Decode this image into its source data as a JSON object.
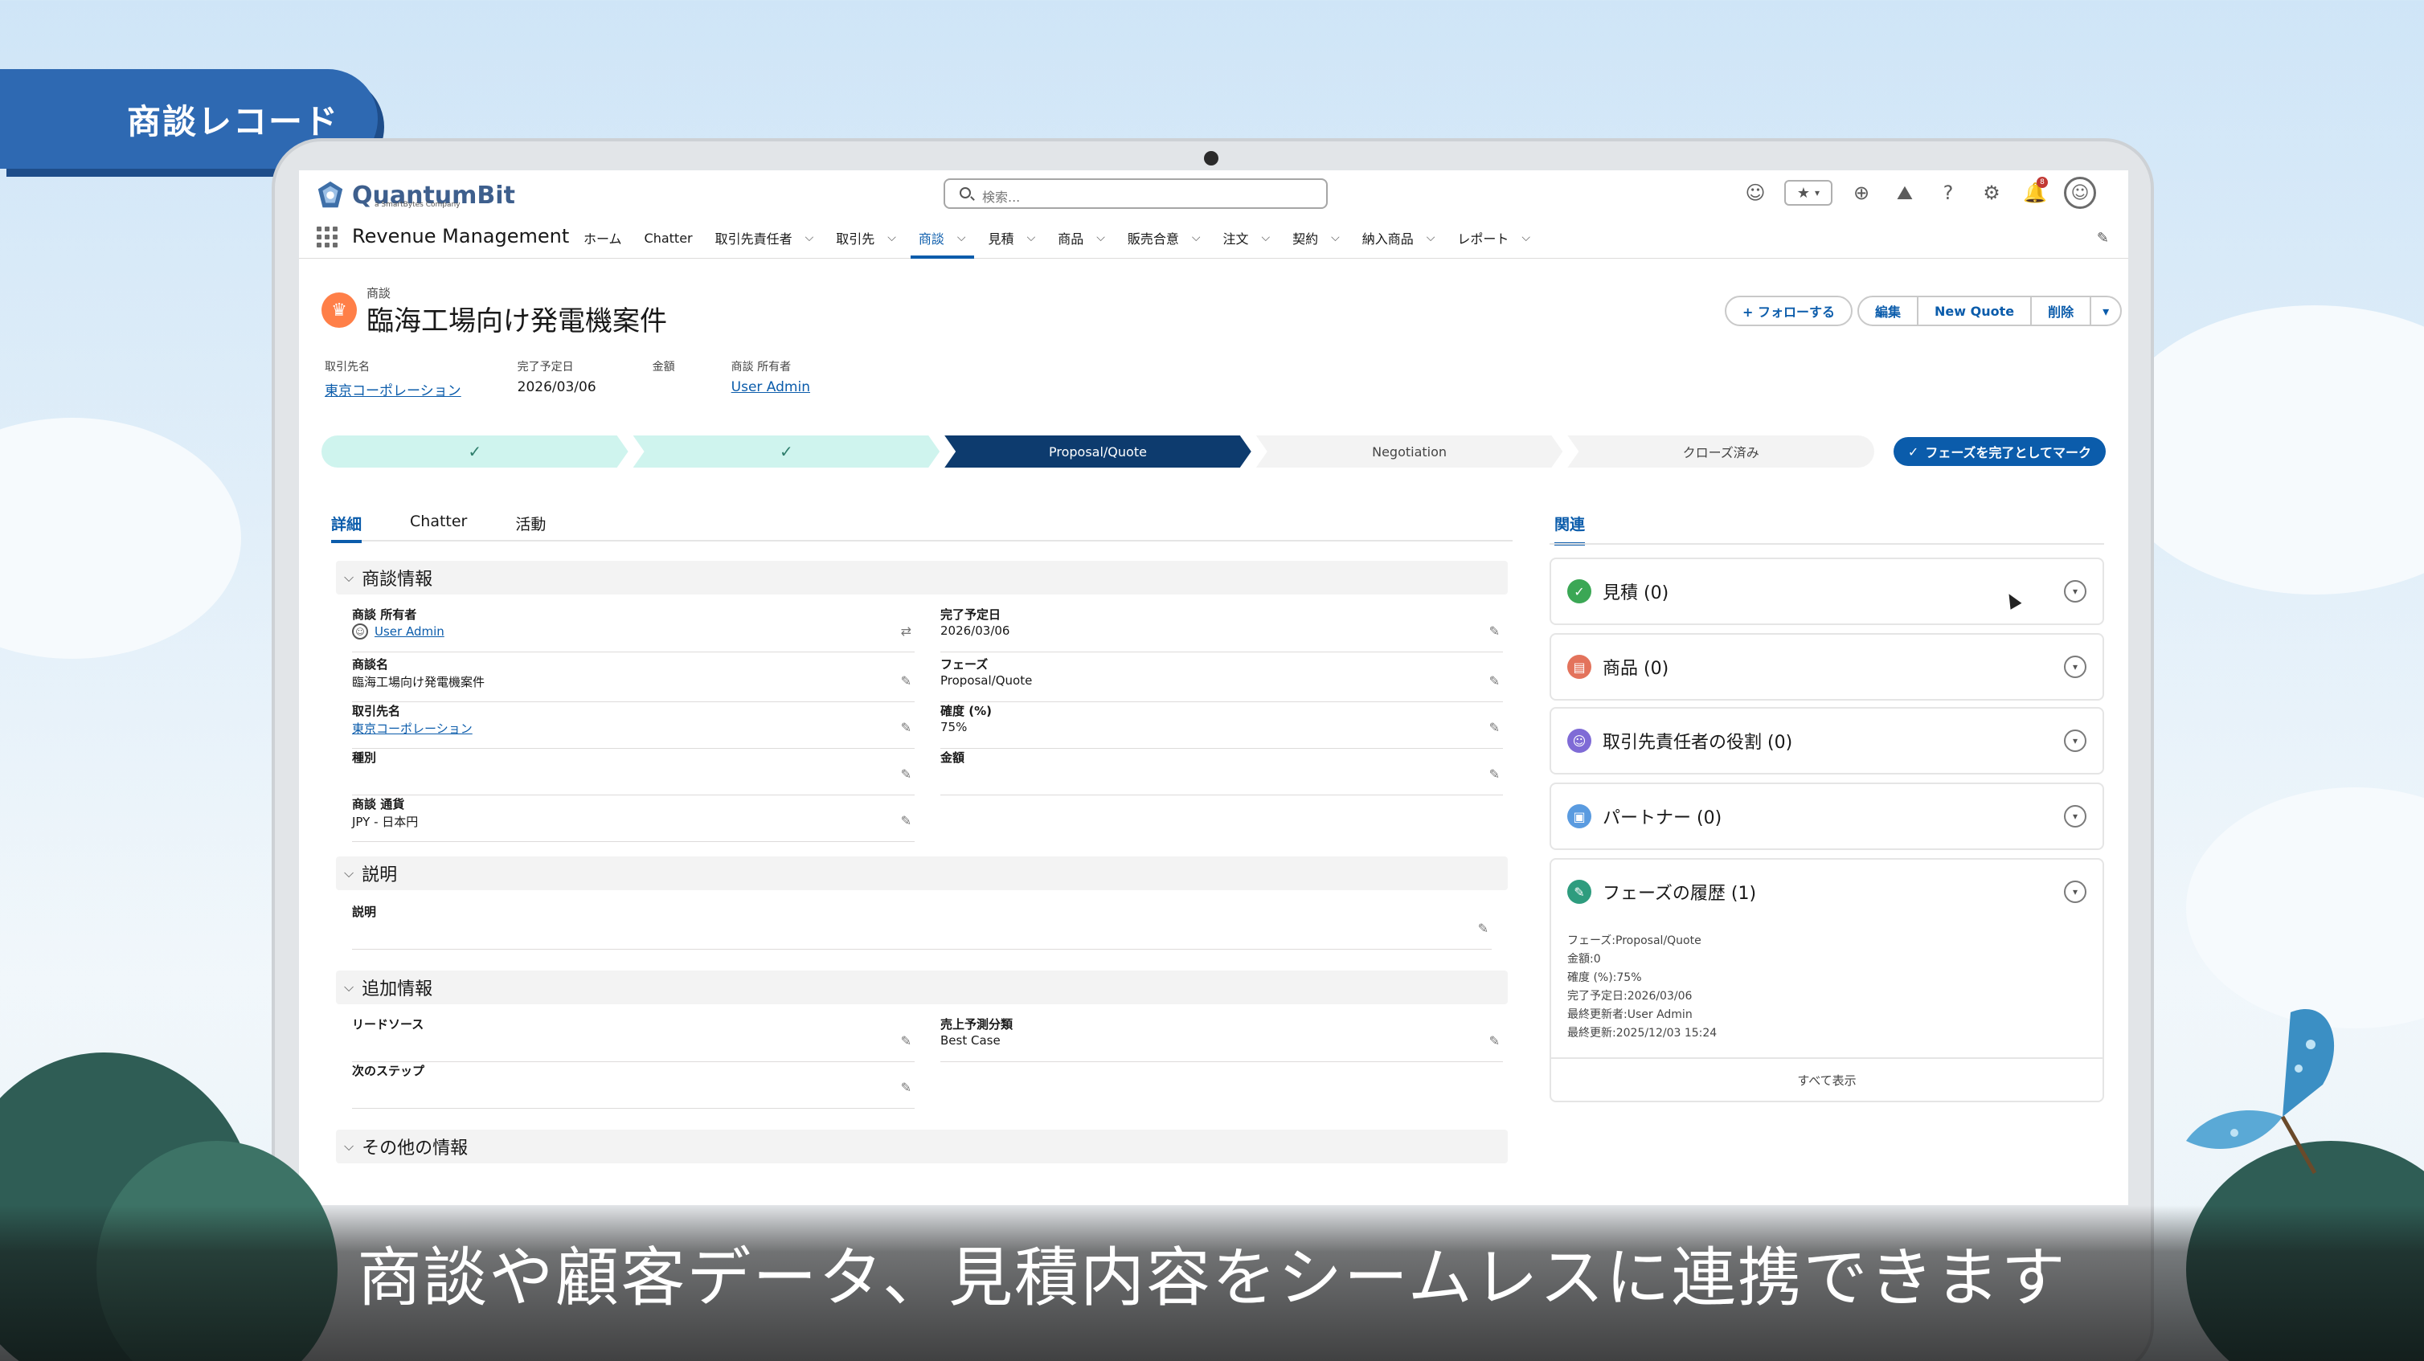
{
  "banner": {
    "title": "商談レコード"
  },
  "caption": {
    "text": "商談や顧客データ、見積内容をシームレスに連携できます"
  },
  "header": {
    "logo_text": "QuantumBit",
    "logo_sub": "a SmartBytes Company",
    "search_placeholder": "検索...",
    "notification_count": "8"
  },
  "nav": {
    "app_name": "Revenue Management",
    "items": [
      {
        "label": "ホーム",
        "has_menu": false
      },
      {
        "label": "Chatter",
        "has_menu": false
      },
      {
        "label": "取引先責任者",
        "has_menu": true
      },
      {
        "label": "取引先",
        "has_menu": true
      },
      {
        "label": "商談",
        "has_menu": true,
        "active": true
      },
      {
        "label": "見積",
        "has_menu": true
      },
      {
        "label": "商品",
        "has_menu": true
      },
      {
        "label": "販売合意",
        "has_menu": true
      },
      {
        "label": "注文",
        "has_menu": true
      },
      {
        "label": "契約",
        "has_menu": true
      },
      {
        "label": "納入商品",
        "has_menu": true
      },
      {
        "label": "レポート",
        "has_menu": true
      }
    ]
  },
  "record": {
    "object_label": "商談",
    "title": "臨海工場向け発電機案件",
    "actions": {
      "follow": "+ フォローする",
      "edit": "編集",
      "new_quote": "New Quote",
      "delete": "削除"
    },
    "highlights": [
      {
        "label": "取引先名",
        "value": "東京コーポレーション",
        "link": true
      },
      {
        "label": "完了予定日",
        "value": "2026/03/06",
        "link": false
      },
      {
        "label": "金額",
        "value": "",
        "link": false
      },
      {
        "label": "商談 所有者",
        "value": "User Admin",
        "link": true
      }
    ]
  },
  "path": {
    "steps": [
      {
        "label": "✓",
        "state": "done"
      },
      {
        "label": "✓",
        "state": "done"
      },
      {
        "label": "Proposal/Quote",
        "state": "current"
      },
      {
        "label": "Negotiation",
        "state": "todo"
      },
      {
        "label": "クローズ済み",
        "state": "todo"
      }
    ],
    "mark_complete": "フェーズを完了としてマーク"
  },
  "tabs": {
    "detail": "詳細",
    "chatter": "Chatter",
    "activity": "活動"
  },
  "sections": {
    "info": "商談情報",
    "desc": "説明",
    "additional": "追加情報",
    "other": "その他の情報"
  },
  "fields": {
    "owner": {
      "label": "商談 所有者",
      "value": "User Admin"
    },
    "close_date": {
      "label": "完了予定日",
      "value": "2026/03/06"
    },
    "name": {
      "label": "商談名",
      "value": "臨海工場向け発電機案件"
    },
    "stage": {
      "label": "フェーズ",
      "value": "Proposal/Quote"
    },
    "account": {
      "label": "取引先名",
      "value": "東京コーポレーション"
    },
    "probability": {
      "label": "確度 (%)",
      "value": "75%"
    },
    "type": {
      "label": "種別",
      "value": ""
    },
    "amount": {
      "label": "金額",
      "value": ""
    },
    "currency": {
      "label": "商談 通貨",
      "value": "JPY - 日本円"
    },
    "description": {
      "label": "説明",
      "value": ""
    },
    "lead_source": {
      "label": "リードソース",
      "value": ""
    },
    "forecast": {
      "label": "売上予測分類",
      "value": "Best Case"
    },
    "next_step": {
      "label": "次のステップ",
      "value": ""
    }
  },
  "related": {
    "tab": "関連",
    "cards": [
      {
        "title": "見積 (0)",
        "color": "#3ba755",
        "icon": "quote-icon"
      },
      {
        "title": "商品 (0)",
        "color": "#e3735c",
        "icon": "product-icon"
      },
      {
        "title": "取引先責任者の役割 (0)",
        "color": "#7f6bd6",
        "icon": "contact-role-icon"
      },
      {
        "title": "パートナー (0)",
        "color": "#5a9be0",
        "icon": "partner-icon"
      },
      {
        "title": "フェーズの履歴 (1)",
        "color": "#2e9c7e",
        "icon": "stage-history-icon"
      }
    ],
    "history": [
      "フェーズ:Proposal/Quote",
      "金額:0",
      "確度 (%):75%",
      "完了予定日:2026/03/06",
      "最終更新者:User Admin",
      "最終更新:2025/12/03 15:24"
    ],
    "view_all": "すべて表示"
  }
}
